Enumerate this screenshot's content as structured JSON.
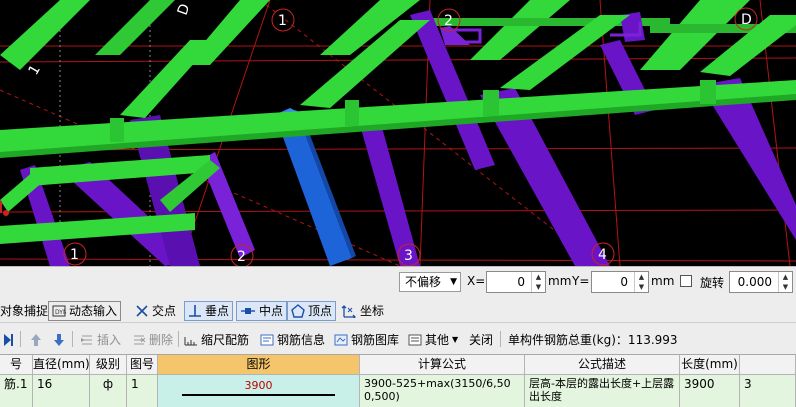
{
  "viewport": {
    "axis_labels": [
      "1",
      "2",
      "D",
      "1",
      "2",
      "3",
      "4"
    ],
    "top_marks": [
      "D",
      "1"
    ]
  },
  "snapbar": {
    "offset_mode": "不偏移",
    "x_label": "X=",
    "x_value": "0",
    "unit_mm": "mm",
    "y_label": "Y=",
    "y_value": "0",
    "rotate_label": "旋转",
    "rotate_value": "0.000",
    "buttons": [
      "对象捕捉",
      "动态输入",
      "交点",
      "垂点",
      "中点",
      "顶点",
      "坐标"
    ]
  },
  "rebarbar": {
    "insert": "插入",
    "delete": "删除",
    "scale_rebar": "缩尺配筋",
    "rebar_info": "钢筋信息",
    "rebar_library": "钢筋图库",
    "other": "其他",
    "close": "关闭",
    "total_weight": "单构件钢筋总重(kg)：113.993"
  },
  "table": {
    "headers": [
      "号",
      "直径(mm)",
      "级别",
      "图号",
      "图形",
      "计算公式",
      "公式描述",
      "长度(mm)",
      ""
    ],
    "row": {
      "name": "筋.1",
      "diameter": "16",
      "grade": "ф",
      "figure_no": "1",
      "shape_value": "3900",
      "formula": "3900-525+max(3150/6,500,500)",
      "description": "层高-本层的露出长度+上层露出长度",
      "length": "3900",
      "count": "3"
    }
  },
  "colors": {
    "beam_green": "#33d93a",
    "column_purple": "#6a14c8",
    "selected_column_blue": "#1d64d8",
    "grid_red": "#b01515",
    "active_header": "#f4c56a",
    "row_background": "#e4f5df",
    "shape_cell": "#c9efe9"
  }
}
